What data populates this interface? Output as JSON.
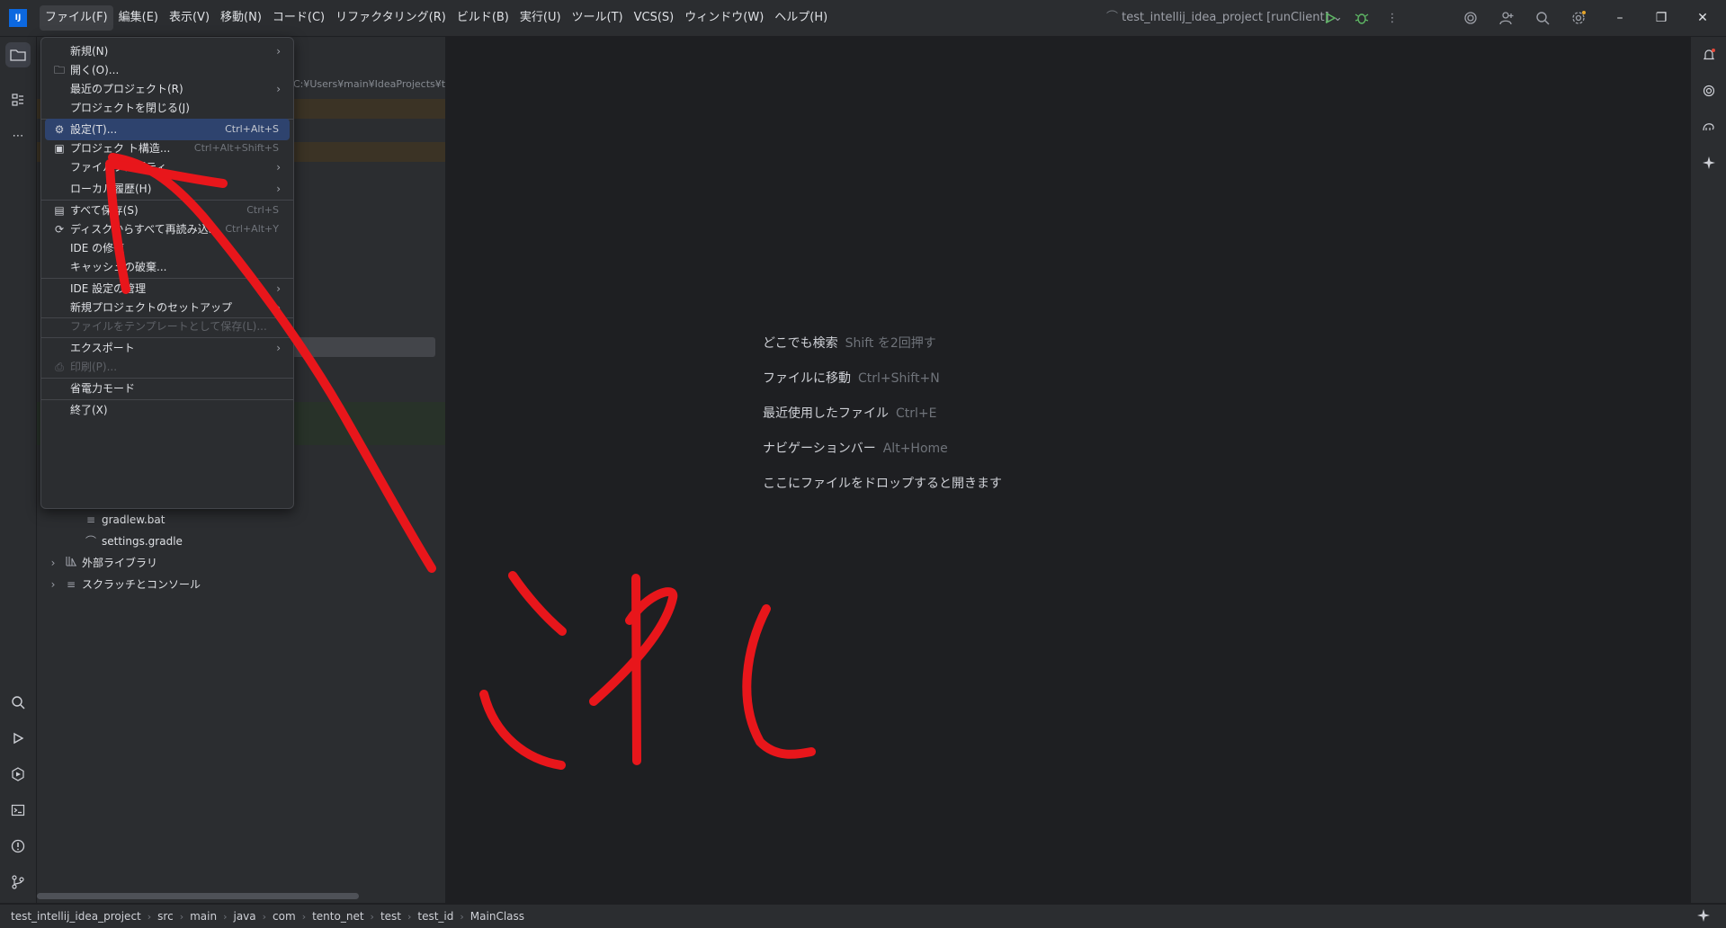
{
  "menubar": {
    "items": [
      "ファイル(F)",
      "編集(E)",
      "表示(V)",
      "移動(N)",
      "コード(C)",
      "リファクタリング(R)",
      "ビルド(B)",
      "実行(U)",
      "ツール(T)",
      "VCS(S)",
      "ウィンドウ(W)",
      "ヘルプ(H)"
    ],
    "active_index": 0
  },
  "titlebar": {
    "app_icon_text": "IJ",
    "project_switcher": "test_intellij_idea_project [runClient]",
    "icons": [
      "run-icon",
      "debug-icon",
      "more-icon",
      "ai-icon",
      "add-user-icon",
      "search-icon",
      "settings-icon"
    ],
    "window_controls": {
      "minimize": "–",
      "maximize": "❐",
      "close": "✕"
    }
  },
  "file_menu": {
    "items": [
      {
        "label": "新規(N)",
        "icon": "",
        "shortcut": "",
        "submenu": true,
        "disabled": false,
        "selected": false
      },
      {
        "label": "開く(O)...",
        "icon": "folder-icon",
        "shortcut": "",
        "submenu": false,
        "disabled": false,
        "selected": false
      },
      {
        "label": "最近のプロジェクト(R)",
        "icon": "",
        "shortcut": "",
        "submenu": true,
        "disabled": false,
        "selected": false
      },
      {
        "label": "プロジェクトを閉じる(J)",
        "icon": "",
        "shortcut": "",
        "submenu": false,
        "disabled": false,
        "selected": false
      },
      {
        "label": "設定(T)...",
        "icon": "gear-icon",
        "shortcut": "Ctrl+Alt+S",
        "submenu": false,
        "disabled": false,
        "selected": true
      },
      {
        "label": "プロジェク ト構造...",
        "icon": "project-structure-icon",
        "shortcut": "Ctrl+Alt+Shift+S",
        "submenu": false,
        "disabled": false,
        "selected": false
      },
      {
        "label": "ファイルプロパティ",
        "icon": "",
        "shortcut": "",
        "submenu": true,
        "disabled": false,
        "selected": false
      },
      {
        "label": "ローカル履歴(H)",
        "icon": "",
        "shortcut": "",
        "submenu": true,
        "disabled": false,
        "selected": false
      },
      {
        "label": "すべて保存(S)",
        "icon": "save-icon",
        "shortcut": "Ctrl+S",
        "submenu": false,
        "disabled": false,
        "selected": false
      },
      {
        "label": "ディスクからすべて再読み込み",
        "icon": "reload-icon",
        "shortcut": "Ctrl+Alt+Y",
        "submenu": false,
        "disabled": false,
        "selected": false
      },
      {
        "label": "IDE の修復",
        "icon": "",
        "shortcut": "",
        "submenu": false,
        "disabled": false,
        "selected": false
      },
      {
        "label": "キャッシュの破棄...",
        "icon": "",
        "shortcut": "",
        "submenu": false,
        "disabled": false,
        "selected": false
      },
      {
        "label": "IDE 設定の管理",
        "icon": "",
        "shortcut": "",
        "submenu": true,
        "disabled": false,
        "selected": false
      },
      {
        "label": "新規プロジェクトのセットアップ",
        "icon": "",
        "shortcut": "",
        "submenu": true,
        "disabled": false,
        "selected": false
      },
      {
        "label": "ファイルをテンプレートとして保存(L)...",
        "icon": "",
        "shortcut": "",
        "submenu": false,
        "disabled": true,
        "selected": false
      },
      {
        "label": "エクスポート",
        "icon": "",
        "shortcut": "",
        "submenu": true,
        "disabled": false,
        "selected": false
      },
      {
        "label": "印刷(P)...",
        "icon": "print-icon",
        "shortcut": "",
        "submenu": false,
        "disabled": true,
        "selected": false
      },
      {
        "label": "省電力モード",
        "icon": "",
        "shortcut": "",
        "submenu": false,
        "disabled": false,
        "selected": false
      },
      {
        "label": "終了(X)",
        "icon": "",
        "shortcut": "",
        "submenu": false,
        "disabled": false,
        "selected": false
      }
    ]
  },
  "project_panel": {
    "path": "C:¥Users¥main¥IdeaProjects¥test",
    "tree": [
      {
        "label": "gradlew.bat",
        "icon": "text-file-icon",
        "expandable": false
      },
      {
        "label": "settings.gradle",
        "icon": "gradle-icon",
        "expandable": false
      },
      {
        "label": "外部ライブラリ",
        "icon": "library-icon",
        "expandable": true
      },
      {
        "label": "スクラッチとコンソール",
        "icon": "scratch-icon",
        "expandable": true
      }
    ]
  },
  "editor_hints": [
    {
      "label": "どこでも検索",
      "key": "Shift を2回押す"
    },
    {
      "label": "ファイルに移動",
      "key": "Ctrl+Shift+N"
    },
    {
      "label": "最近使用したファイル",
      "key": "Ctrl+E"
    },
    {
      "label": "ナビゲーションバー",
      "key": "Alt+Home"
    },
    {
      "label": "ここにファイルをドロップすると開きます",
      "key": ""
    }
  ],
  "status_bar": {
    "breadcrumbs": [
      "test_intellij_idea_project",
      "src",
      "main",
      "java",
      "com",
      "tento_net",
      "test",
      "test_id",
      "MainClass"
    ]
  },
  "annotation": {
    "text": "これ",
    "color": "#e8161b"
  }
}
